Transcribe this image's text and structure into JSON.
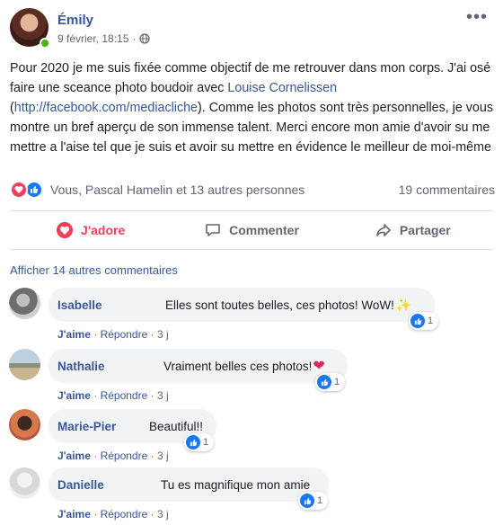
{
  "post": {
    "author": "Émily",
    "timestamp": "9 février, 18:15",
    "separator": "·",
    "text_part1": "Pour 2020 je me suis fixée comme objectif de me retrouver dans mon corps. J'ai osé faire une sceance photo boudoir avec ",
    "tagged_name": "Louise Cornelissen",
    "text_part2": " (",
    "tagged_link": "http://facebook.com/mediacliche",
    "text_part3": "). Comme les photos sont très personnelles, je vous montre un bref aperçu de son immense talent. Merci encore mon amie d'avoir su me mettre a l'aise tel que je suis et avoir su mettre en évidence le meilleur de moi-même"
  },
  "reactions": {
    "summary": "Vous, Pascal Hamelin et 13 autres personnes",
    "comments_count": "19 commentaires"
  },
  "actions": {
    "adore": "J'adore",
    "comment": "Commenter",
    "share": "Partager"
  },
  "more_comments": "Afficher 14 autres commentaires",
  "comments": [
    {
      "name": "Isabelle",
      "text": "Elles sont toutes belles, ces photos! WoW!",
      "like": "J'aime",
      "reply": "Répondre",
      "time": "3 j",
      "likes": "1"
    },
    {
      "name": "Nathalie",
      "text": "Vraiment belles ces photos!",
      "like": "J'aime",
      "reply": "Répondre",
      "time": "3 j",
      "likes": "1"
    },
    {
      "name": "Marie-Pier",
      "text": "Beautiful!!",
      "like": "J'aime",
      "reply": "Répondre",
      "time": "3 j",
      "likes": "1"
    },
    {
      "name": "Danielle",
      "text": "Tu es magnifique mon amie",
      "like": "J'aime",
      "reply": "Répondre",
      "time": "3 j",
      "likes": "1"
    }
  ],
  "colors": {
    "link": "#385898",
    "love": "#f33e58",
    "like": "#1877f2",
    "muted": "#606770"
  }
}
